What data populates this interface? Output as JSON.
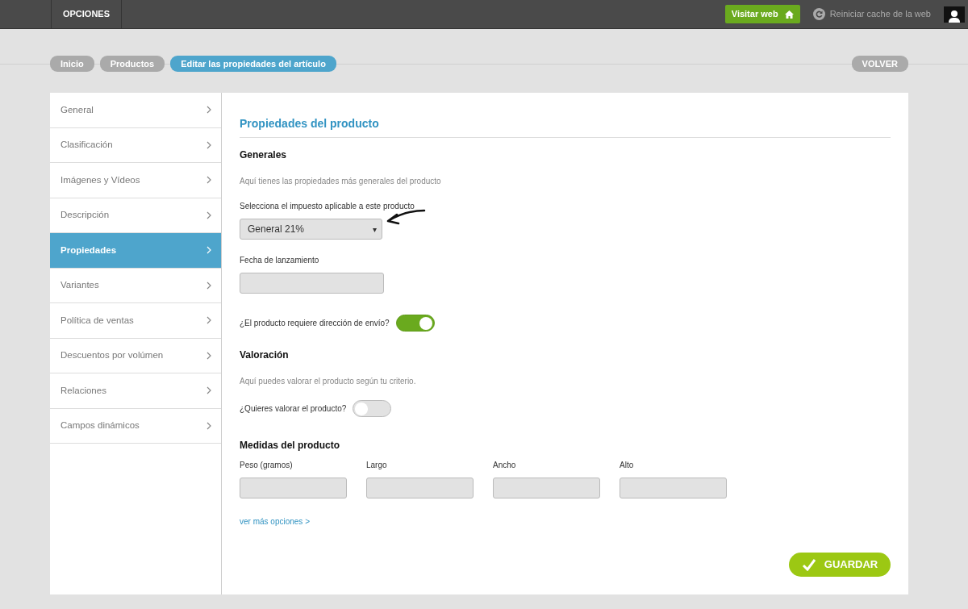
{
  "topbar": {
    "section": "OPCIONES",
    "visit_button": "Visitar web",
    "reset_link": "Reiniciar cache de la web"
  },
  "breadcrumbs": [
    {
      "label": "Inicio",
      "selected": false
    },
    {
      "label": "Productos",
      "selected": false
    },
    {
      "label": "Editar las propiedades del artículo",
      "selected": true
    }
  ],
  "back_button": "VOLVER",
  "sidebar": {
    "items": [
      {
        "label": "General",
        "selected": false
      },
      {
        "label": "Clasificación",
        "selected": false
      },
      {
        "label": "Imágenes y Vídeos",
        "selected": false
      },
      {
        "label": "Descripción",
        "selected": false
      },
      {
        "label": "Propiedades",
        "selected": true
      },
      {
        "label": "Variantes",
        "selected": false
      },
      {
        "label": "Política de ventas",
        "selected": false
      },
      {
        "label": "Descuentos por volúmen",
        "selected": false
      },
      {
        "label": "Relaciones",
        "selected": false
      },
      {
        "label": "Campos dinámicos",
        "selected": false
      }
    ]
  },
  "panel": {
    "title": "Propiedades del producto",
    "sections": [
      {
        "heading": "Generales",
        "description": "Aquí tienes las propiedades más generales del producto",
        "fields": [
          {
            "kind": "select",
            "label": "Selecciona el impuesto aplicable a este producto",
            "value": "General 21%",
            "caret": "▾"
          },
          {
            "kind": "text",
            "label": "Fecha de lanzamiento"
          },
          {
            "kind": "toggle",
            "label": "¿El producto requiere dirección de envío?",
            "on": true
          }
        ]
      },
      {
        "heading": "Valoración",
        "description": "Aquí puedes valorar el producto según tu criterio.",
        "fields": [
          {
            "kind": "toggle",
            "label": "¿Quieres valorar el producto?",
            "on": false
          }
        ]
      }
    ],
    "measures": {
      "heading": "Medidas del producto",
      "fields": [
        {
          "label": "Peso (gramos)"
        },
        {
          "label": "Largo"
        },
        {
          "label": "Ancho"
        },
        {
          "label": "Alto"
        }
      ]
    },
    "more_link": "ver más opciones >",
    "save_button": "GUARDAR"
  }
}
